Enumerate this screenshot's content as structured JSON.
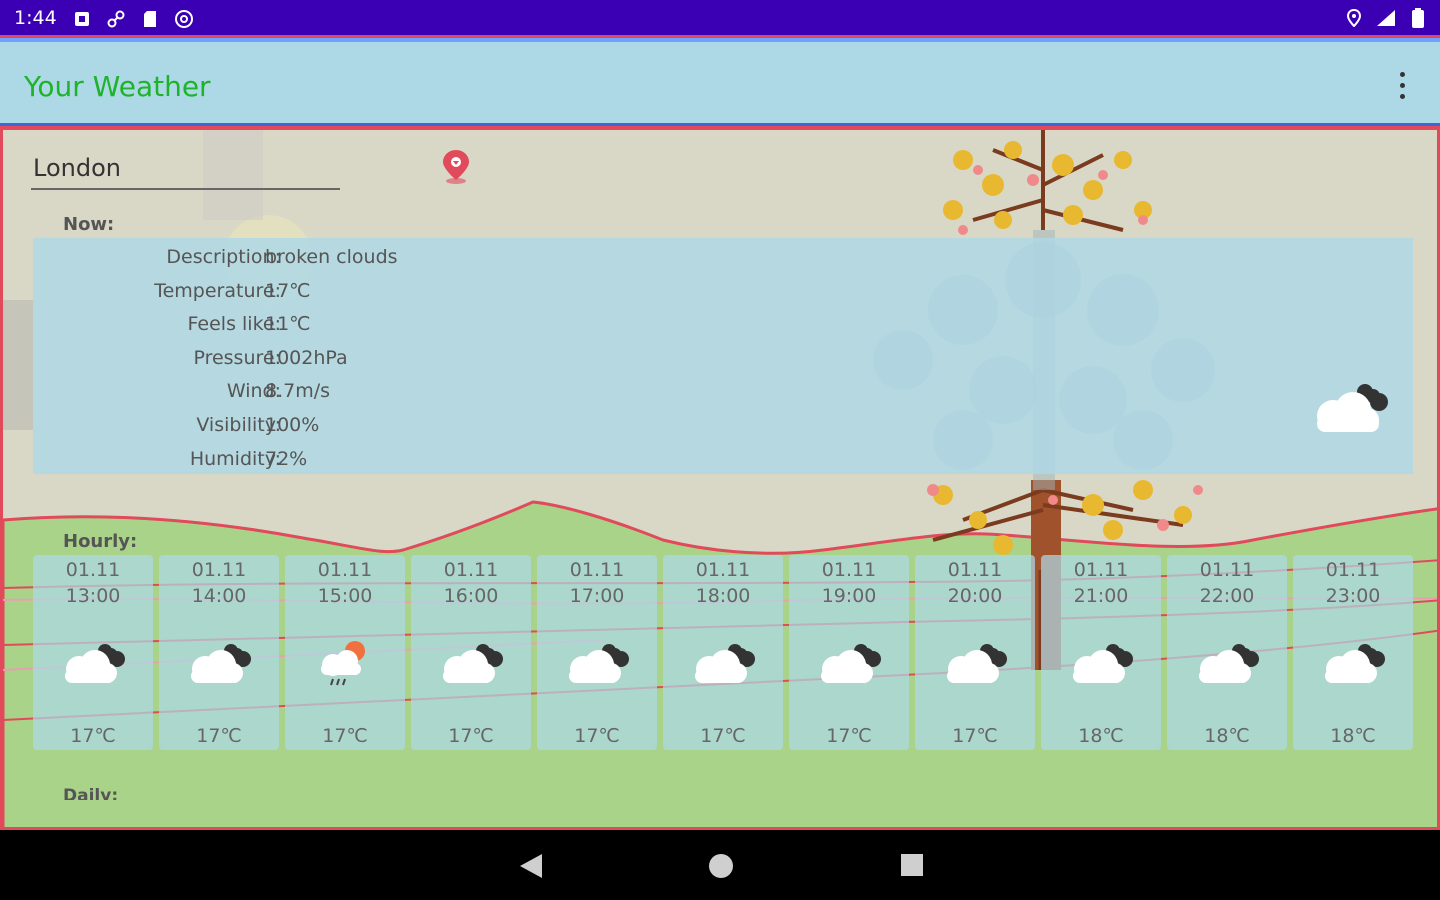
{
  "status_bar": {
    "time": "1:44"
  },
  "app_bar": {
    "title": "Your Weather"
  },
  "search": {
    "city": "London"
  },
  "now": {
    "label": "Now:",
    "rows": [
      {
        "key": "Description:",
        "value": "broken clouds"
      },
      {
        "key": "Temperature:",
        "value": "17℃"
      },
      {
        "key": "Feels like:",
        "value": "11℃"
      },
      {
        "key": "Pressure:",
        "value": "1002hPa"
      },
      {
        "key": "Wind:",
        "value": "8.7m/s"
      },
      {
        "key": "Visibility:",
        "value": "100%"
      },
      {
        "key": "Humidity:",
        "value": "72%"
      }
    ],
    "icon": "broken-clouds-icon"
  },
  "hourly": {
    "label": "Hourly:",
    "items": [
      {
        "date": "01.11",
        "time": "13:00",
        "temp": "17℃",
        "icon": "broken-clouds-icon"
      },
      {
        "date": "01.11",
        "time": "14:00",
        "temp": "17℃",
        "icon": "broken-clouds-icon"
      },
      {
        "date": "01.11",
        "time": "15:00",
        "temp": "17℃",
        "icon": "sun-rain-cloud-icon"
      },
      {
        "date": "01.11",
        "time": "16:00",
        "temp": "17℃",
        "icon": "broken-clouds-icon"
      },
      {
        "date": "01.11",
        "time": "17:00",
        "temp": "17℃",
        "icon": "broken-clouds-icon"
      },
      {
        "date": "01.11",
        "time": "18:00",
        "temp": "17℃",
        "icon": "broken-clouds-icon"
      },
      {
        "date": "01.11",
        "time": "19:00",
        "temp": "17℃",
        "icon": "broken-clouds-icon"
      },
      {
        "date": "01.11",
        "time": "20:00",
        "temp": "17℃",
        "icon": "broken-clouds-icon"
      },
      {
        "date": "01.11",
        "time": "21:00",
        "temp": "18℃",
        "icon": "broken-clouds-icon"
      },
      {
        "date": "01.11",
        "time": "22:00",
        "temp": "18℃",
        "icon": "broken-clouds-icon"
      },
      {
        "date": "01.11",
        "time": "23:00",
        "temp": "18℃",
        "icon": "broken-clouds-icon"
      }
    ]
  },
  "daily": {
    "label": "Daily:"
  },
  "colors": {
    "status_bar": "#3c00b4",
    "app_bar": "#add8e6",
    "title": "#1fb32a",
    "panel": "#add8e6",
    "accent_line": "#e04a5b"
  }
}
